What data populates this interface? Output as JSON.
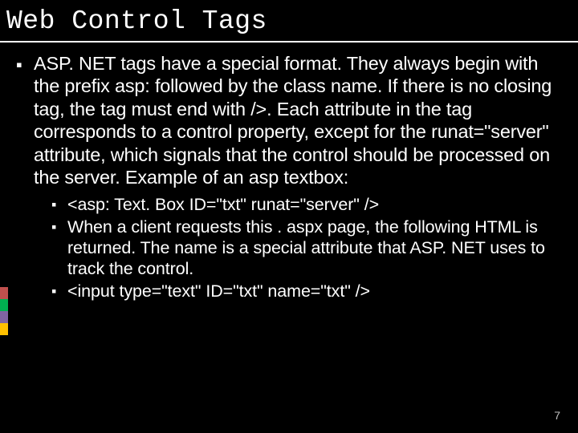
{
  "title": "Web Control Tags",
  "main_bullet": "ASP. NET tags have a special format. They always begin with the prefix asp: followed by the class name. If there is no closing tag, the tag must end with />. Each attribute in the tag corresponds to a control property, except for the runat=\"server\" attribute, which signals that the control should be processed on the server. Example of an asp textbox:",
  "sub_bullets": [
    "<asp: Text. Box ID=\"txt\" runat=\"server\" />",
    "When a client requests this . aspx page, the following HTML is returned. The name is a special attribute that ASP. NET uses to track the control.",
    "<input type=\"text\" ID=\"txt\" name=\"txt\" />"
  ],
  "page_number": "7"
}
